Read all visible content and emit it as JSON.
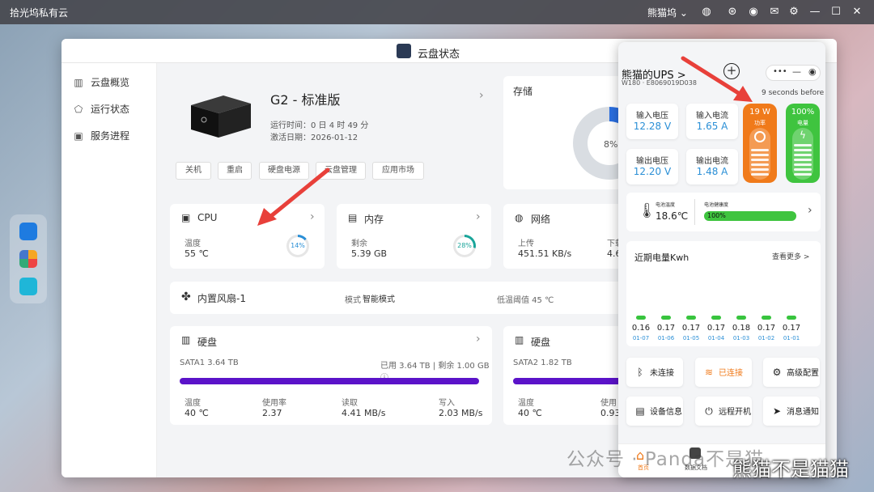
{
  "topbar": {
    "app_title": "拾光坞私有云",
    "username": "熊猫坞 ⌄",
    "icons": [
      "globe-icon",
      "bluetooth-icon",
      "user-icon",
      "mail-icon",
      "gear-icon",
      "minimize-icon",
      "maximize-icon",
      "close-icon"
    ]
  },
  "dock": {
    "apps": [
      "dashboard-app-icon",
      "apps-grid-icon",
      "media-player-icon"
    ]
  },
  "window": {
    "title": "云盘状态",
    "sidebar": [
      {
        "label": "云盘概览",
        "icon": "chart-icon"
      },
      {
        "label": "运行状态",
        "icon": "status-icon"
      },
      {
        "label": "服务进程",
        "icon": "process-icon"
      }
    ],
    "device": {
      "name": "G2 - 标准版",
      "uptime": "运行时间：0 日 4 时 49 分",
      "activated": "激活日期：2026-01-12",
      "buttons": [
        "关机",
        "重启",
        "硬盘电源",
        "云盘管理",
        "应用市场"
      ]
    },
    "storage": {
      "title": "存储",
      "percent_label": "8%",
      "percent": 8
    },
    "cpu": {
      "title": "CPU",
      "temp_label": "温度",
      "temp": "55 ℃",
      "usage_label": "14%",
      "usage": 14
    },
    "memory": {
      "title": "内存",
      "free_label": "剩余",
      "free": "5.39 GB",
      "usage_label": "28%",
      "usage": 28
    },
    "network": {
      "title": "网络",
      "up_label": "上传",
      "up": "451.51 KB/s",
      "down_label": "下载",
      "down": "4.6"
    },
    "fan": {
      "title": "内置风扇-1",
      "mode_label": "模式",
      "mode": "智能模式",
      "threshold": "低温阈值 45 ℃"
    },
    "disk1": {
      "title": "硬盘",
      "name": "SATA1 3.64 TB",
      "usage": "已用 3.64 TB | 剩余 1.00 GB ⓘ",
      "fill": 99.97,
      "stats": [
        {
          "label": "温度",
          "value": "40 ℃"
        },
        {
          "label": "使用率",
          "value": "2.37"
        },
        {
          "label": "读取",
          "value": "4.41 MB/s"
        },
        {
          "label": "写入",
          "value": "2.03 MB/s"
        }
      ]
    },
    "disk2": {
      "title": "硬盘",
      "name": "SATA2 1.82 TB",
      "fill": 100,
      "stats": [
        {
          "label": "温度",
          "value": "40 ℃"
        },
        {
          "label": "使用",
          "value": "0.93"
        }
      ]
    }
  },
  "ups": {
    "title": "熊猫的UPS >",
    "subtitle": "W180 · E8069019D038",
    "updated": "9 seconds before",
    "metrics": [
      {
        "label": "输入电压",
        "value": "12.28 V"
      },
      {
        "label": "输入电流",
        "value": "1.65 A"
      },
      {
        "label": "输出电压",
        "value": "12.20 V"
      },
      {
        "label": "输出电流",
        "value": "1.48 A"
      }
    ],
    "power": {
      "value": "19 W",
      "label": "功率"
    },
    "battery": {
      "value": "100%",
      "label": "电量"
    },
    "temp": {
      "label": "电池温度",
      "value": "18.6℃"
    },
    "health": {
      "label": "电池健康度",
      "value": "100%",
      "percent": 100
    },
    "energy": {
      "title": "近期电量Kwh",
      "more": "查看更多 >",
      "values": [
        "0.16",
        "0.17",
        "0.17",
        "0.17",
        "0.18",
        "0.17",
        "0.17"
      ],
      "dates": [
        "01-07",
        "01-06",
        "01-05",
        "01-04",
        "01-03",
        "01-02",
        "01-01"
      ]
    },
    "actions": [
      {
        "label": "未连接",
        "icon": "bluetooth-icon",
        "color": "#222222"
      },
      {
        "label": "已连接",
        "icon": "wifi-icon",
        "color": "#f07a1a"
      },
      {
        "label": "高级配置",
        "icon": "gear-icon",
        "color": "#222222"
      },
      {
        "label": "设备信息",
        "icon": "info-icon",
        "color": "#222222"
      },
      {
        "label": "远程开机",
        "icon": "power-icon",
        "color": "#222222"
      },
      {
        "label": "消息通知",
        "icon": "send-icon",
        "color": "#222222"
      }
    ],
    "bottom_nav": [
      {
        "label": "首页"
      },
      {
        "label": "数据文档"
      }
    ]
  },
  "watermark": {
    "text1": "公众号 · Panda不是猫",
    "text2": "熊猫不是猫猫"
  }
}
